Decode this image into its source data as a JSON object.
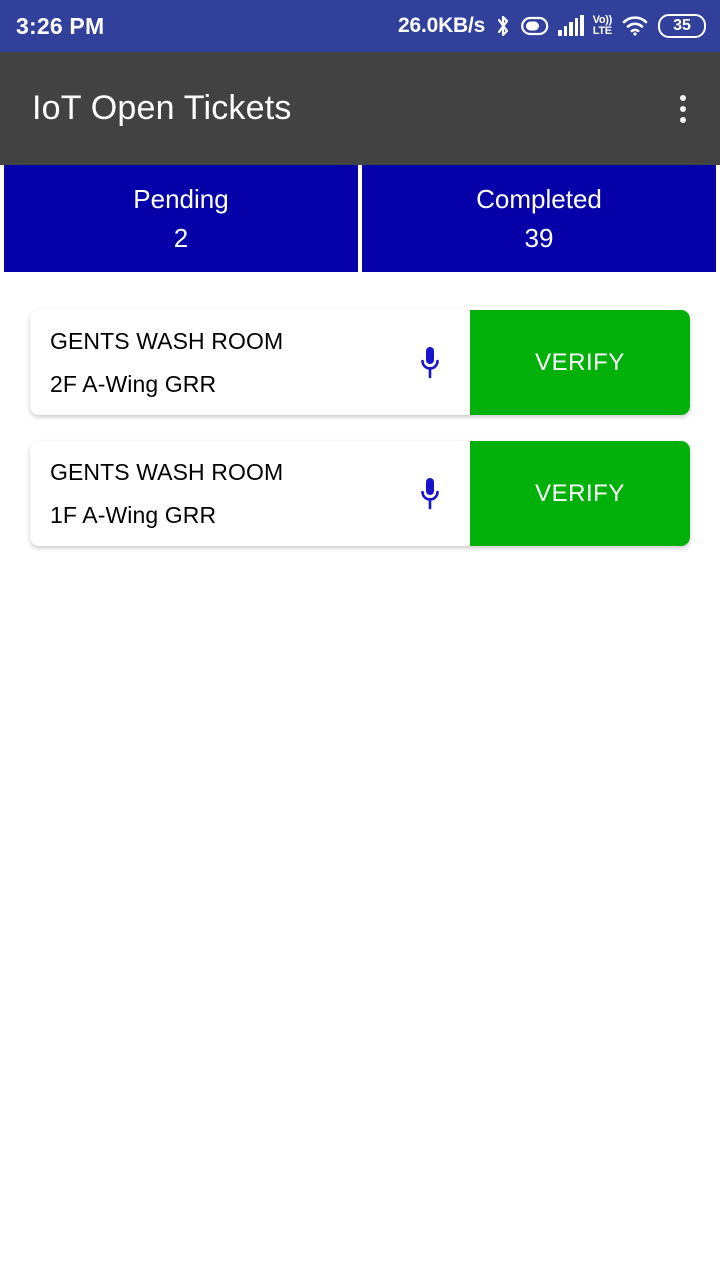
{
  "status_bar": {
    "clock": "3:26 PM",
    "network_speed": "26.0KB/s",
    "bluetooth_icon": "bluetooth-icon",
    "alarm_icon": "capsule-icon",
    "signal_icon": "signal-bars-icon",
    "volte_top": "Vo))",
    "volte_bottom": "LTE",
    "wifi_icon": "wifi-icon",
    "battery_level": "35",
    "background_color": "#31409B"
  },
  "app_bar": {
    "title": "IoT Open Tickets",
    "overflow_icon": "more-vertical-icon",
    "background_color": "#424242"
  },
  "tabs": [
    {
      "label": "Pending",
      "count": "2"
    },
    {
      "label": "Completed",
      "count": "39"
    }
  ],
  "tab_color": "#0600A8",
  "verify_color": "#01B009",
  "mic_color": "#1A13CC",
  "tickets": [
    {
      "title": "GENTS WASH ROOM",
      "location": "2F A-Wing GRR",
      "mic_icon": "microphone-icon",
      "action_label": "VERIFY"
    },
    {
      "title": "GENTS WASH ROOM",
      "location": "1F A-Wing GRR",
      "mic_icon": "microphone-icon",
      "action_label": "VERIFY"
    }
  ]
}
